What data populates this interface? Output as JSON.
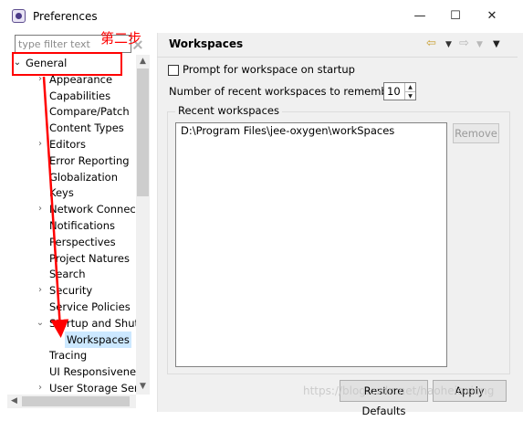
{
  "window": {
    "title": "Preferences",
    "controls": {
      "minimize": "—",
      "maximize": "☐",
      "close": "✕"
    }
  },
  "filter": {
    "placeholder": "type filter text"
  },
  "tree": {
    "items": [
      {
        "label": "General",
        "level": 0,
        "expanded": true
      },
      {
        "label": "Appearance",
        "level": 1,
        "collapsed": true
      },
      {
        "label": "Capabilities",
        "level": 1
      },
      {
        "label": "Compare/Patch",
        "level": 1
      },
      {
        "label": "Content Types",
        "level": 1
      },
      {
        "label": "Editors",
        "level": 1,
        "collapsed": true
      },
      {
        "label": "Error Reporting",
        "level": 1
      },
      {
        "label": "Globalization",
        "level": 1
      },
      {
        "label": "Keys",
        "level": 1
      },
      {
        "label": "Network Connectio",
        "level": 1,
        "collapsed": true
      },
      {
        "label": "Notifications",
        "level": 1
      },
      {
        "label": "Perspectives",
        "level": 1
      },
      {
        "label": "Project Natures",
        "level": 1
      },
      {
        "label": "Search",
        "level": 1
      },
      {
        "label": "Security",
        "level": 1,
        "collapsed": true
      },
      {
        "label": "Service Policies",
        "level": 1
      },
      {
        "label": "Startup and Shutd",
        "level": 1,
        "expanded": true
      },
      {
        "label": "Workspaces",
        "level": 2,
        "selected": true
      },
      {
        "label": "Tracing",
        "level": 1
      },
      {
        "label": "UI Responsiveness",
        "level": 1
      },
      {
        "label": "User Storage Serv",
        "level": 1,
        "collapsed": true
      }
    ]
  },
  "page": {
    "heading": "Workspaces",
    "prompt_label": "Prompt for workspace on startup",
    "prompt_checked": false,
    "recent_count_label": "Number of recent workspaces to remember:",
    "recent_count_value": "10",
    "recent_group_title": "Recent workspaces",
    "recent_items": [
      "D:\\Program Files\\jee-oxygen\\workSpaces"
    ],
    "remove_label": "Remove",
    "restore_label": "Restore Defaults",
    "apply_label": "Apply"
  },
  "icons": {
    "back": "⇦",
    "forward": "⇨",
    "dropdown": "▼",
    "twisty_collapsed": "›",
    "twisty_expanded": "⌄"
  },
  "annotation": {
    "text": "第二步",
    "color": "#ff0000"
  },
  "watermark": "https://blog.csdn.net/haoheiaxiong"
}
